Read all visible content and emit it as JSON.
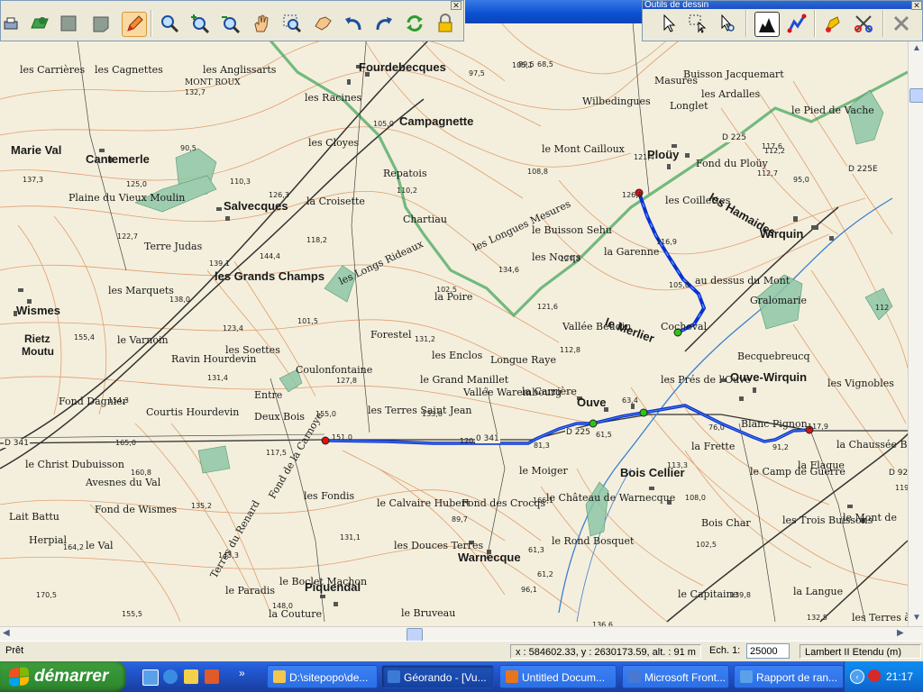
{
  "app": {
    "title": "Géorando - [Vu...",
    "drawing_toolbar_title": "Outils de dessin"
  },
  "toolbar_main": {
    "buttons": [
      "print-icon",
      "open-map-icon",
      "layer-icon",
      "layer2-icon",
      "pencil-icon",
      "zoom-icon",
      "zoom-in-icon",
      "zoom-out-icon",
      "pan-hand-icon",
      "zoom-window-icon",
      "grab-icon",
      "undo-icon",
      "redo-icon",
      "refresh-icon",
      "lock-icon"
    ]
  },
  "toolbar_draw": {
    "buttons": [
      "pointer-icon",
      "select-rect-icon",
      "select-zoom-icon",
      "profile-icon",
      "route-icon",
      "waypoint-icon",
      "cut-route-icon",
      "delete-icon"
    ]
  },
  "map": {
    "places": [
      {
        "name": "Fourdebecques",
        "cls": "big"
      },
      {
        "name": "Campagnette",
        "cls": "big"
      },
      {
        "name": "Ploüy",
        "cls": "big"
      },
      {
        "name": "Cantemerle",
        "cls": "big"
      },
      {
        "name": "Marie Val",
        "cls": "big"
      },
      {
        "name": "Salvecques",
        "cls": "big"
      },
      {
        "name": "les Grands Champs",
        "cls": "big"
      },
      {
        "name": "Wismes",
        "cls": "big"
      },
      {
        "name": "Rietz",
        "cls": "med"
      },
      {
        "name": "Moutu",
        "cls": "med"
      },
      {
        "name": "Wirquin",
        "cls": "big"
      },
      {
        "name": "Ouve-Wirquin",
        "cls": "big"
      },
      {
        "name": "Ouve",
        "cls": "big"
      },
      {
        "name": "le Merlier",
        "cls": "big"
      },
      {
        "name": "Bois Cellier",
        "cls": "big"
      },
      {
        "name": "Warnecque",
        "cls": "big"
      },
      {
        "name": "Piquendal",
        "cls": "big"
      },
      {
        "name": "les Hamaides",
        "cls": "big"
      },
      {
        "name": "MONT ROUX",
        "cls": "small"
      },
      {
        "name": "les Carrières",
        "cls": ""
      },
      {
        "name": "les Cagnettes",
        "cls": ""
      },
      {
        "name": "les Anglissarts",
        "cls": ""
      },
      {
        "name": "les Racines",
        "cls": ""
      },
      {
        "name": "les Cloyes",
        "cls": ""
      },
      {
        "name": "Repatois",
        "cls": ""
      },
      {
        "name": "la Croisette",
        "cls": ""
      },
      {
        "name": "Plaine du Vieux Moulin",
        "cls": ""
      },
      {
        "name": "Terre Judas",
        "cls": ""
      },
      {
        "name": "les Marquets",
        "cls": ""
      },
      {
        "name": "le Varnoin",
        "cls": ""
      },
      {
        "name": "Forestel",
        "cls": ""
      },
      {
        "name": "Coulonfontaine",
        "cls": ""
      },
      {
        "name": "le Grand Manillet",
        "cls": ""
      },
      {
        "name": "Vallée Warembourg",
        "cls": ""
      },
      {
        "name": "les Terres Saint Jean",
        "cls": ""
      },
      {
        "name": "Courtis Hourdevin",
        "cls": ""
      },
      {
        "name": "Deux Bois",
        "cls": ""
      },
      {
        "name": "le Christ Dubuisson",
        "cls": ""
      },
      {
        "name": "Avesnes du Val",
        "cls": ""
      },
      {
        "name": "Fond de Wismes",
        "cls": ""
      },
      {
        "name": "les Fondis",
        "cls": ""
      },
      {
        "name": "le Moiger",
        "cls": ""
      },
      {
        "name": "la Garenne",
        "cls": ""
      },
      {
        "name": "le Buisson Sehu",
        "cls": ""
      },
      {
        "name": "les Nocqs",
        "cls": ""
      },
      {
        "name": "la Poire",
        "cls": ""
      },
      {
        "name": "Longue Raye",
        "cls": ""
      },
      {
        "name": "la Carrière",
        "cls": ""
      },
      {
        "name": "les Coillettes",
        "cls": ""
      },
      {
        "name": "Fond du Ploüy",
        "cls": ""
      },
      {
        "name": "Longlet",
        "cls": ""
      },
      {
        "name": "les Ardalles",
        "cls": ""
      },
      {
        "name": "le Pied de Vache",
        "cls": ""
      },
      {
        "name": "Buisson Jacquemart",
        "cls": ""
      },
      {
        "name": "Masures",
        "cls": ""
      },
      {
        "name": "les Vignobles",
        "cls": ""
      },
      {
        "name": "la Frette",
        "cls": ""
      },
      {
        "name": "le Camp de Guerre",
        "cls": ""
      },
      {
        "name": "la Flaque",
        "cls": ""
      },
      {
        "name": "Bois Char",
        "cls": ""
      },
      {
        "name": "les Trois Buissons",
        "cls": ""
      },
      {
        "name": "le Rond Bosquet",
        "cls": ""
      },
      {
        "name": "les Douces Terres",
        "cls": ""
      },
      {
        "name": "le Boclet Machon",
        "cls": ""
      },
      {
        "name": "la Couture",
        "cls": ""
      },
      {
        "name": "le Bruveau",
        "cls": ""
      },
      {
        "name": "le Capitaine",
        "cls": ""
      },
      {
        "name": "la Langue",
        "cls": ""
      },
      {
        "name": "la Chaussée Brunehaut",
        "cls": ""
      },
      {
        "name": "le Mont de",
        "cls": ""
      },
      {
        "name": "les Terres à Bo",
        "cls": ""
      },
      {
        "name": "Lait Battu",
        "cls": ""
      },
      {
        "name": "Herpial",
        "cls": ""
      },
      {
        "name": "le Val",
        "cls": ""
      },
      {
        "name": "Gralomarie",
        "cls": ""
      },
      {
        "name": "Cocheval",
        "cls": ""
      },
      {
        "name": "Becquebreucq",
        "cls": ""
      },
      {
        "name": "Blanc Pignon",
        "cls": ""
      },
      {
        "name": "le Paradis",
        "cls": ""
      },
      {
        "name": "les Soettes",
        "cls": ""
      },
      {
        "name": "Entre",
        "cls": ""
      },
      {
        "name": "Chartiau",
        "cls": ""
      },
      {
        "name": "le Mont Cailloux",
        "cls": ""
      },
      {
        "name": "Wilbedingues",
        "cls": ""
      },
      {
        "name": "Vallée Beudin",
        "cls": ""
      },
      {
        "name": "les Enclos",
        "cls": ""
      },
      {
        "name": "les Longues Mesures",
        "cls": ""
      },
      {
        "name": "les Longs Rideaux",
        "cls": ""
      },
      {
        "name": "Fond de la Carnoye",
        "cls": ""
      },
      {
        "name": "le Calvaire Hubert",
        "cls": ""
      },
      {
        "name": "Fond des Crocqs",
        "cls": ""
      },
      {
        "name": "Fond Dagnier",
        "cls": ""
      },
      {
        "name": "Ravin Hourdevin",
        "cls": ""
      },
      {
        "name": "au dessus du Mont",
        "cls": ""
      },
      {
        "name": "le Château de Warnecque",
        "cls": ""
      },
      {
        "name": "Terres du Renard",
        "cls": ""
      },
      {
        "name": "les Prés de l'Ouve",
        "cls": ""
      }
    ],
    "spot_heights": [
      "132,7",
      "90,5",
      "137,3",
      "125,0",
      "110,3",
      "122,7",
      "126,3",
      "118,2",
      "139,1",
      "144,4",
      "105,0",
      "110,2",
      "97,5",
      "105,1",
      "108,8",
      "121,4",
      "126,9",
      "116,9",
      "105,0",
      "117,6",
      "112,7",
      "95,0",
      "134,6",
      "127,3",
      "121,6",
      "112,8",
      "102,5",
      "101,5",
      "123,4",
      "131,2",
      "138,0",
      "155,4",
      "131,4",
      "127,8",
      "133,8",
      "155,0",
      "154,3",
      "165,0",
      "151,0",
      "117,5",
      "120,8",
      "81,3",
      "61,5",
      "63,4",
      "76,0",
      "91,2",
      "117,9",
      "113,3",
      "108,0",
      "166,1",
      "96,1",
      "89,7",
      "61,3",
      "61,2",
      "102,5",
      "131,1",
      "143,3",
      "135,2",
      "164,2",
      "170,5",
      "155,5",
      "148,0",
      "136,6",
      "132,5",
      "139,8",
      "160,8",
      "112,2",
      "89,5",
      "68,5",
      "112",
      "119"
    ],
    "roads": [
      "D 225",
      "D 225E",
      "D 341",
      "D 928",
      "D 225",
      "0 341"
    ],
    "route": {
      "color": "#0a30d0",
      "waypoints": [
        {
          "type": "start"
        },
        {
          "type": "via"
        },
        {
          "type": "via"
        },
        {
          "type": "end"
        },
        {
          "type": "start"
        },
        {
          "type": "via"
        },
        {
          "type": "end"
        }
      ]
    }
  },
  "statusbar": {
    "left": "Prêt",
    "coords": "x : 584602.33, y : 2630173.59, alt. : 91 m",
    "scale_label": "Ech. 1:",
    "scale_value": "25000",
    "projection": "Lambert II Etendu (m)"
  },
  "taskbar": {
    "start_label": "démarrer",
    "tasks": [
      {
        "label": "D:\\sitepopo\\de...",
        "icon": "folder-icon",
        "color": "#f3c64d",
        "active": false
      },
      {
        "label": "Géorando - [Vu...",
        "icon": "georando-icon",
        "color": "#3b7bd6",
        "active": true
      },
      {
        "label": "Untitled Docum...",
        "icon": "firefox-icon",
        "color": "#e5761d",
        "active": false
      },
      {
        "label": "Microsoft Front...",
        "icon": "frontpage-icon",
        "color": "#4a78d0",
        "active": false
      },
      {
        "label": "Rapport de ran...",
        "icon": "ie-icon",
        "color": "#5aa1e8",
        "active": false
      }
    ],
    "clock": "21:17"
  }
}
